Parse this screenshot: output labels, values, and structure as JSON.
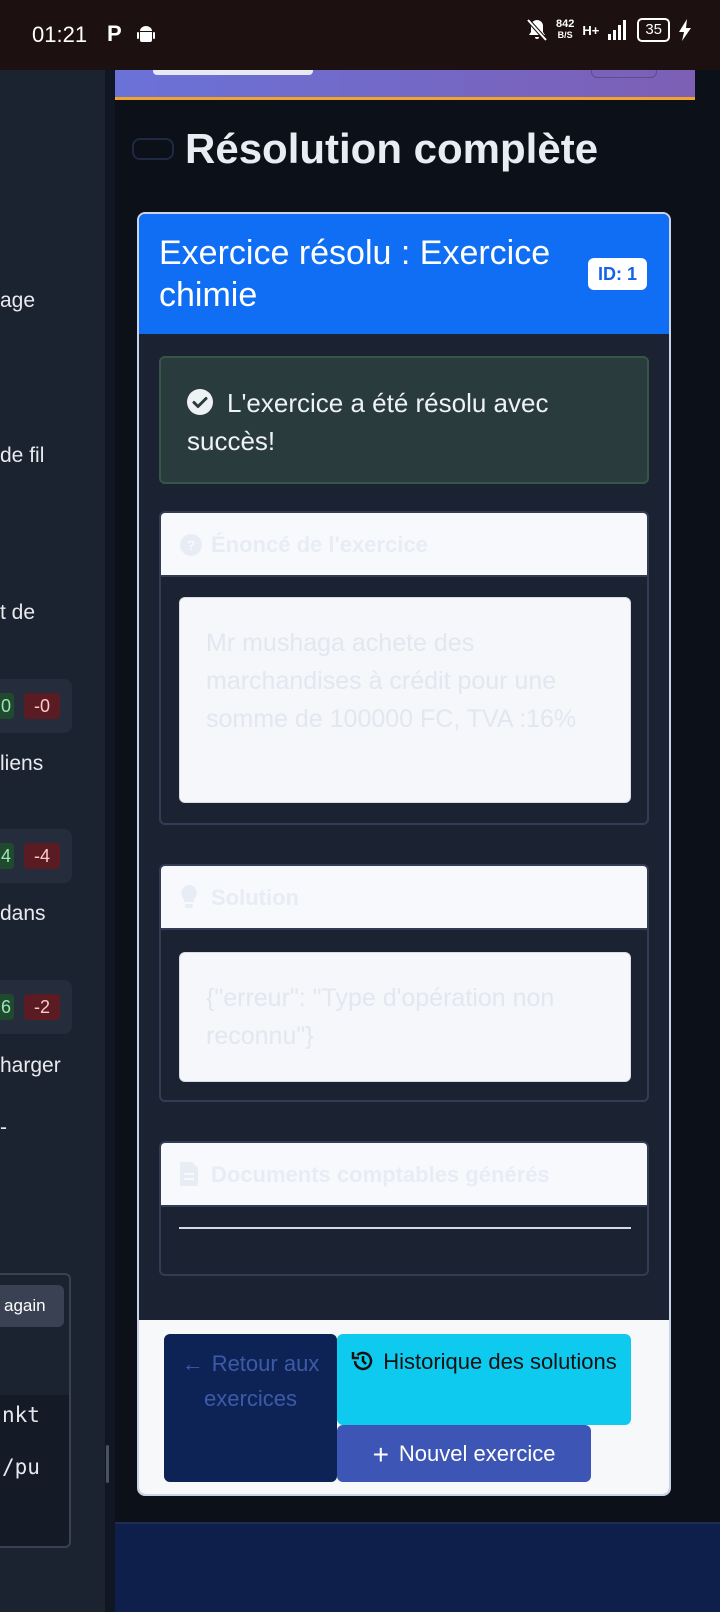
{
  "status_bar": {
    "time": "01:21",
    "p_icon": "P",
    "net_speed_value": "842",
    "net_speed_unit": "B/S",
    "network_type": "H+",
    "battery": "35",
    "icons": [
      "parking-icon",
      "android-icon",
      "bell-muted-icon",
      "signal-icon",
      "battery-icon",
      "charging-icon"
    ]
  },
  "sidebar": {
    "text_fragments": [
      "age",
      "de fil",
      "t de",
      "liens",
      "dans",
      "harger",
      "-"
    ],
    "diffs": [
      {
        "added": "0",
        "removed": "-0"
      },
      {
        "added": "4",
        "removed": "-4"
      },
      {
        "added": "6",
        "removed": "-2"
      }
    ],
    "again_button": "again",
    "code_lines": [
      "nkt",
      "/pu"
    ]
  },
  "page": {
    "title": "Résolution complète"
  },
  "card": {
    "title": "Exercice résolu : Exercice chimie",
    "id_badge": "ID: 1",
    "success_message": "L'exercice a été résolu avec succès!",
    "sections": {
      "statement": {
        "header": "Énoncé de l'exercice",
        "body": "Mr mushaga achete des marchandises à crédit pour une somme de 100000 FC, TVA :16%"
      },
      "solution": {
        "header": "Solution",
        "body": "{\"erreur\": \"Type d'opération non reconnu\"}"
      },
      "documents": {
        "header": "Documents comptables générés"
      }
    },
    "buttons": {
      "back": "Retour aux exercices",
      "history": "Historique des solutions",
      "new": "Nouvel exercice"
    }
  },
  "colors": {
    "accent_blue": "#0f6ef4",
    "success_bg": "#2a3b3d",
    "history_cyan": "#0fcaef",
    "new_button": "#3d55b5",
    "back_button": "#0e2355"
  }
}
